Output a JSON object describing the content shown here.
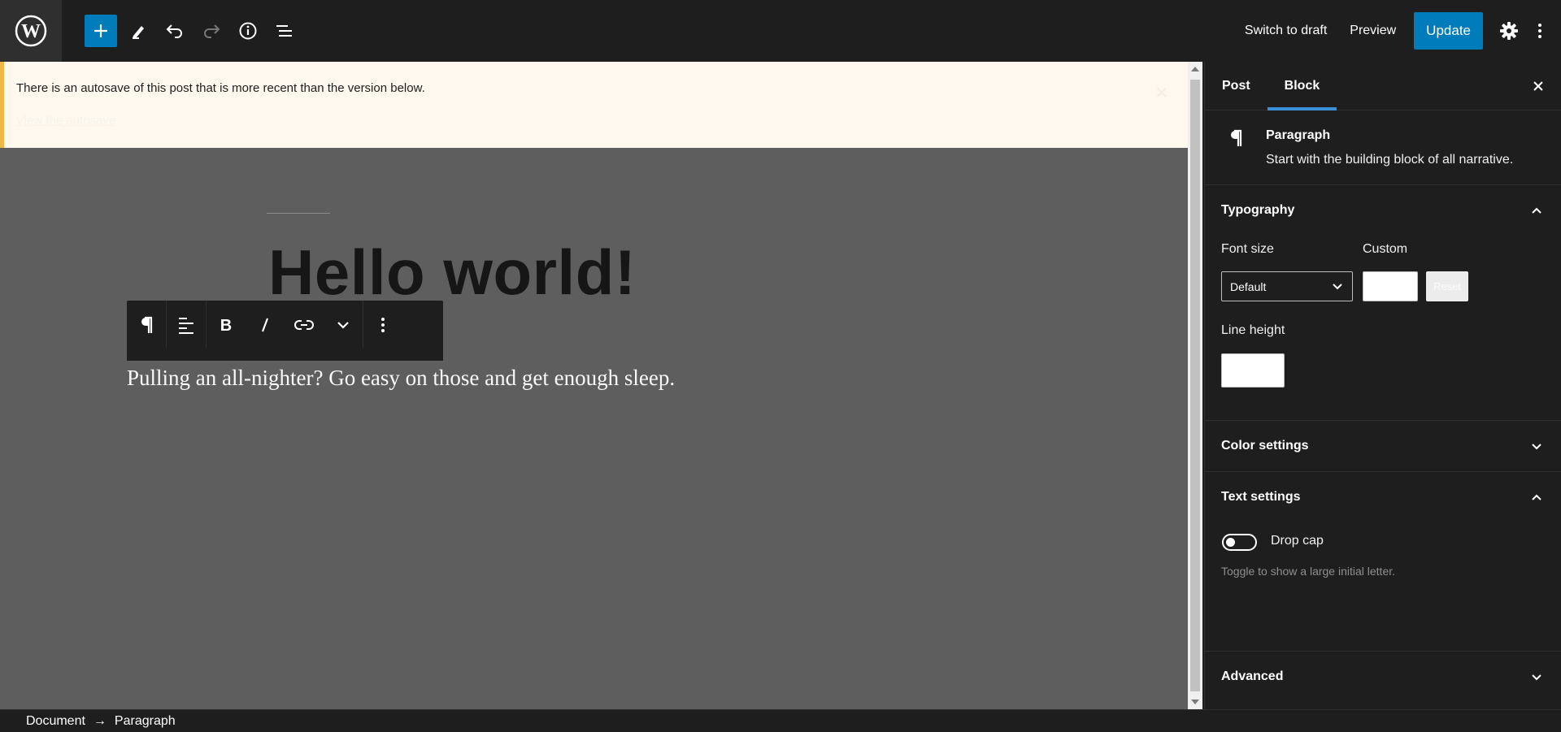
{
  "topbar": {
    "switch_to_draft": "Switch to draft",
    "preview": "Preview",
    "update": "Update",
    "icons": [
      "wordpress-logo",
      "plus-icon",
      "pencil-icon",
      "undo-icon",
      "redo-icon",
      "info-icon",
      "list-view-icon",
      "gear-icon",
      "more-vertical-icon"
    ]
  },
  "notice": {
    "text": "There is an autosave of this post that is more recent than the version below.",
    "link": "View the autosave"
  },
  "editor": {
    "title": "Hello world!",
    "paragraph": "Pulling an all-nighter? Go easy on those and get enough sleep."
  },
  "sidebar": {
    "tabs": [
      {
        "label": "Post",
        "active": false
      },
      {
        "label": "Block",
        "active": true
      }
    ],
    "block": {
      "title": "Paragraph",
      "description": "Start with the building block of all narrative."
    },
    "typography": {
      "title": "Typography",
      "font_size_label": "Font size",
      "custom_label": "Custom",
      "font_size_value": "Default",
      "reset": "Reset",
      "line_height_label": "Line height"
    },
    "color_settings": {
      "title": "Color settings"
    },
    "text_settings": {
      "title": "Text settings",
      "drop_cap": "Drop cap",
      "help": "Toggle to show a large initial letter."
    },
    "advanced": {
      "title": "Advanced"
    }
  },
  "footer": {
    "crumb1": "Document",
    "arrow": "→",
    "crumb2": "Paragraph"
  },
  "colors": {
    "accent": "#007cba",
    "notice_bg": "#fef8ee",
    "notice_border": "#f0b849",
    "canvas": "#5e5e5e",
    "chrome": "#1e1e1e"
  }
}
